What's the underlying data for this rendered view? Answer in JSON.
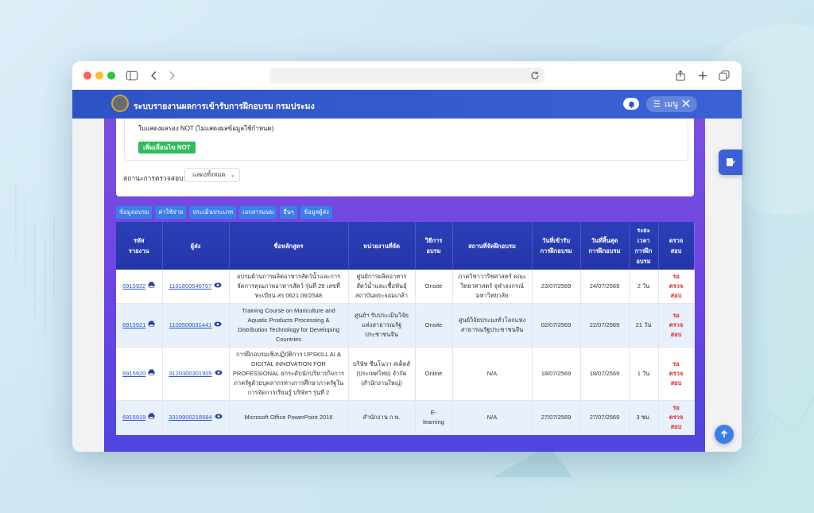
{
  "app": {
    "title": "ระบบรายงานผลการเข้ารับการฝึกอบรม กรมประมง",
    "menu_label": "เมนู"
  },
  "card": {
    "note": "ใบแสดงผลรอง NOT (ไม่แสดงผลข้อมูลใช้กำหนด)",
    "add_button": "เพิ่มเลื่อนไข NOT",
    "status_label": "สถานะการตรวจสอบ:",
    "status_value": "แสดงทั้งหมด"
  },
  "tabs": [
    "ข้อมูลอบรม",
    "ค่าใช้จ่าย",
    "ประเมินประเภท",
    "เอกสารแนบ",
    "อื่นๆ",
    "ข้อมูลผู้ส่ง"
  ],
  "table": {
    "headers": [
      "รหัส\nรายงาน",
      "ผู้ส่ง",
      "ชื่อหลักสูตร",
      "หน่วยงานที่จัด",
      "วิธีการ\nอบรม",
      "สถานที่จัดฝึกอบรม",
      "วันที่เข้ารับ\nการฝึกอบรม",
      "วันที่สิ้นสุด\nการฝึกอบรม",
      "ระยะ\nเวลา\nการฝึก\nอบรม",
      "ตรวจ\nสอบ"
    ],
    "rows": [
      {
        "id": "6915922",
        "sender": "1101800546707",
        "course": "อบรมด้านการผลิตอาหารสัตว์น้ำและการจัดการคุณภาพอาหารสัตว์ รุ่นที่ 29 เลขที่ทะเบียน สร 0621.06/2548",
        "org": "ศูนย์การผลิตอาหารสัตว์น้ำและเชื้อพันธุ์ สถาบันพระจอมเกล้า",
        "method": "Onsite",
        "place": "ภาควิชาวาริชศาสตร์ คณะวิทยาศาสตร์ จุฬาลงกรณ์มหาวิทยาลัย",
        "start": "23/07/2569",
        "end": "24/07/2569",
        "duration": "2 วัน",
        "status": "รอ\nตรวจ\nสอบ"
      },
      {
        "id": "6915921",
        "sender": "1100500031441",
        "course": "Training Course on Mariculture and Aquatic Products Processing & Distribution Technology for Developing Countries",
        "org": "ศูนย์ฯ รับประเมินวิจัย แห่งสาธารณรัฐประชาชนจีน",
        "method": "Onsite",
        "place": "ศูนย์วิจัยประมงทั่วโลกแห่งสาธารณรัฐประชาชนจีน",
        "start": "02/07/2569",
        "end": "22/07/2569",
        "duration": "21 วัน",
        "status": "รอ\nตรวจ\nสอบ"
      },
      {
        "id": "6915920",
        "sender": "3120300301905",
        "course": "การฝึกอบรมเชิงปฏิบัติการ UPSKILL AI & DIGITAL INNOVATION FOR PROFESSIONAL ยกระดับนักบริหารกิจการภาครัฐด้วยบุคลากรทางการศึกษาภาครัฐในการจัดการเรียนรู้ บริษัทฯ รุ่นที่ 2",
        "org": "บริษัท ซีนโนวา สเต็ดส์ (ประเทศไทย) จำกัด (สำนักงานใหญ่)",
        "method": "Online",
        "place": "N/A",
        "start": "18/07/2569",
        "end": "18/07/2569",
        "duration": "1 วัน",
        "status": "รอ\nตรวจ\nสอบ"
      },
      {
        "id": "6915919",
        "sender": "3319900218584",
        "course": "Microsoft Office PowerPoint 2016",
        "org": "สำนักงาน ก.พ.",
        "method": "E-\nlearning",
        "place": "N/A",
        "start": "27/07/2569",
        "end": "27/07/2569",
        "duration": "3 ชม.",
        "status": "รอ\nตรวจ\nสอบ"
      }
    ]
  },
  "colors": {
    "appbar": "#2e53c6",
    "accent_purple": "#7a4fe0",
    "tab_blue": "#3b7ee9",
    "green": "#2ebd5a",
    "pending_red": "#e03030",
    "header_navy": "#2436a8"
  }
}
